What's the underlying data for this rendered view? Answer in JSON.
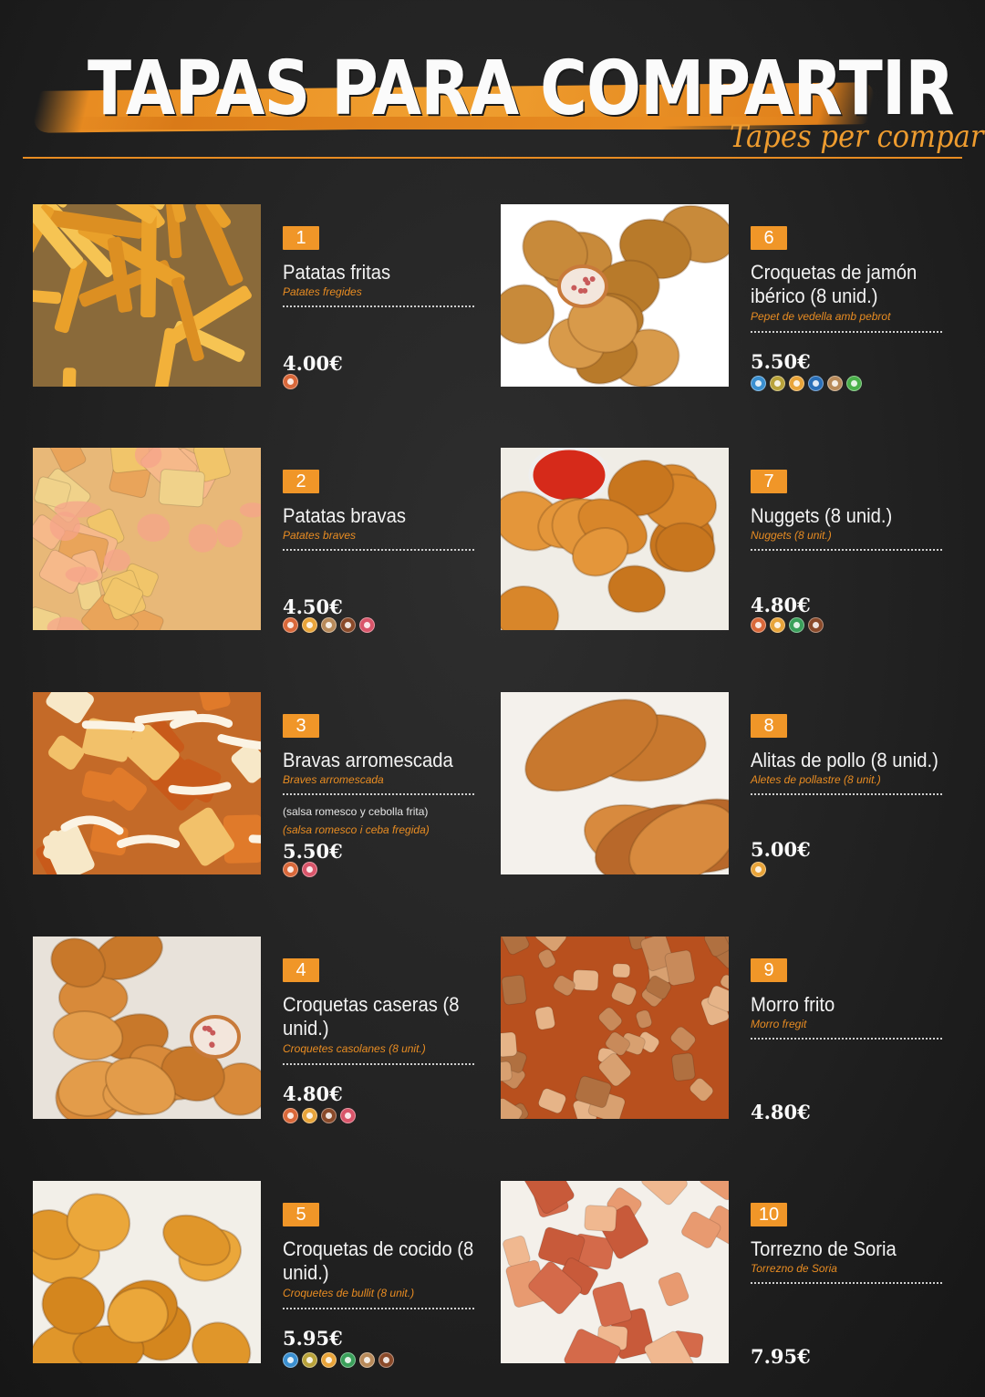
{
  "header": {
    "title": "TAPAS PARA COMPARTIR",
    "subtitle": "Tapes per compartir"
  },
  "colors": {
    "accent": "#e88c22",
    "background": "#222222"
  },
  "items": [
    {
      "number": "1",
      "name": "Patatas fritas",
      "translation": "Patates fregides",
      "price": "4.00€",
      "allergens": [
        {
          "icon": "celery-icon",
          "color": "#d9683a"
        }
      ]
    },
    {
      "number": "2",
      "name": "Patatas bravas",
      "translation": "Patates braves",
      "price": "4.50€",
      "allergens": [
        {
          "icon": "celery-icon",
          "color": "#d9683a"
        },
        {
          "icon": "egg-icon",
          "color": "#e8a43a"
        },
        {
          "icon": "mustard-icon",
          "color": "#b88a5a"
        },
        {
          "icon": "sulphite-icon",
          "color": "#8a4a2a"
        },
        {
          "icon": "milk-icon",
          "color": "#d9556a"
        }
      ]
    },
    {
      "number": "3",
      "name": "Bravas arromescada",
      "translation": "Braves arromescada",
      "note": "(salsa romesco y cebolla frita)",
      "note_translation": "(salsa romesco i ceba fregida)",
      "price": "5.50€",
      "allergens": [
        {
          "icon": "celery-icon",
          "color": "#d9683a"
        },
        {
          "icon": "milk-icon",
          "color": "#d9556a"
        }
      ]
    },
    {
      "number": "4",
      "name": "Croquetas caseras (8 unid.)",
      "translation": "Croquetes casolanes (8 unit.)",
      "price": "4.80€",
      "allergens": [
        {
          "icon": "celery-icon",
          "color": "#d9683a"
        },
        {
          "icon": "egg-icon",
          "color": "#e8a43a"
        },
        {
          "icon": "sulphite-icon",
          "color": "#8a4a2a"
        },
        {
          "icon": "milk-icon",
          "color": "#d9556a"
        }
      ]
    },
    {
      "number": "5",
      "name": "Croquetas de cocido (8 unid.)",
      "translation": "Croquetes de bullit (8 unit.)",
      "price": "5.95€",
      "allergens": [
        {
          "icon": "crustacean-icon",
          "color": "#3a8fd0"
        },
        {
          "icon": "gluten-icon",
          "color": "#b8a23a"
        },
        {
          "icon": "egg-icon",
          "color": "#e8a43a"
        },
        {
          "icon": "soy-icon",
          "color": "#3aa05a"
        },
        {
          "icon": "mustard-icon",
          "color": "#b88a5a"
        },
        {
          "icon": "sulphite-icon",
          "color": "#8a4a2a"
        }
      ]
    },
    {
      "number": "6",
      "name": "Croquetas de jamón ibérico (8 unid.)",
      "translation": "Pepet de vedella amb pebrot",
      "price": "5.50€",
      "allergens": [
        {
          "icon": "crustacean-icon",
          "color": "#3a8fd0"
        },
        {
          "icon": "gluten-icon",
          "color": "#b8a23a"
        },
        {
          "icon": "egg-icon",
          "color": "#e8a43a"
        },
        {
          "icon": "fish-icon",
          "color": "#2a6fb8"
        },
        {
          "icon": "mustard-icon",
          "color": "#b88a5a"
        },
        {
          "icon": "lupin-icon",
          "color": "#4ab04a"
        }
      ]
    },
    {
      "number": "7",
      "name": "Nuggets (8 unid.)",
      "translation": "Nuggets (8 unit.)",
      "price": "4.80€",
      "allergens": [
        {
          "icon": "celery-icon",
          "color": "#d9683a"
        },
        {
          "icon": "egg-icon",
          "color": "#e8a43a"
        },
        {
          "icon": "soy-icon",
          "color": "#3aa05a"
        },
        {
          "icon": "sulphite-icon",
          "color": "#8a4a2a"
        }
      ]
    },
    {
      "number": "8",
      "name": "Alitas de pollo (8 unid.)",
      "translation": "Aletes de pollastre (8 unit.)",
      "price": "5.00€",
      "allergens": [
        {
          "icon": "egg-icon",
          "color": "#e8a43a"
        }
      ]
    },
    {
      "number": "9",
      "name": "Morro frito",
      "translation": "Morro fregit",
      "price": "4.80€",
      "allergens": []
    },
    {
      "number": "10",
      "name": "Torrezno de Soria",
      "translation": "Torrezno de Soria",
      "price": "7.95€",
      "allergens": []
    }
  ]
}
